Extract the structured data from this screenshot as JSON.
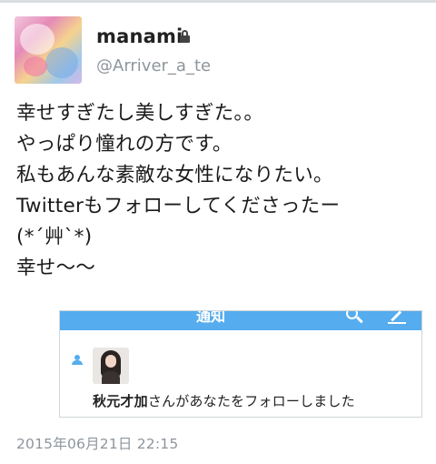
{
  "user": {
    "display_name": "manami",
    "handle": "@Arriver_a_te",
    "protected_icon": "lock-icon",
    "avatar_icon": "profile-photo"
  },
  "tweet": {
    "lines": [
      "幸せすぎたし美しすぎた。。",
      "やっぱり憧れの方です。",
      "私もあんな素敵な女性になりたい。",
      "Twitterもフォローしてくださったー",
      "(*´艸`*)",
      "幸せ〜〜"
    ],
    "timestamp": "2015年06月21日 22:15"
  },
  "embedded_screenshot": {
    "header_title": "通知",
    "header_color": "#55acee",
    "header_icons": [
      "search-icon",
      "compose-icon"
    ],
    "notification": {
      "icon": "follow-person-icon",
      "follower_name": "秋元才加",
      "message": "さんがあなたをフォローしました"
    }
  }
}
